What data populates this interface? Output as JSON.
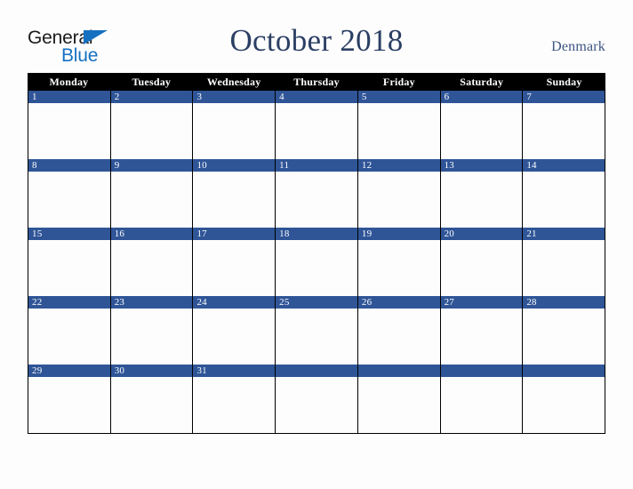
{
  "brand": {
    "logo_line1": "General",
    "logo_line2": "Blue",
    "logo_triangle_icon": "triangle-icon",
    "primary_color": "#1670c0"
  },
  "header": {
    "title": "October 2018",
    "month": "October",
    "year": "2018",
    "country": "Denmark",
    "title_color": "#2b3f64",
    "country_color": "#3d5582"
  },
  "calendar": {
    "weekday_headers": [
      "Monday",
      "Tuesday",
      "Wednesday",
      "Thursday",
      "Friday",
      "Saturday",
      "Sunday"
    ],
    "header_bg_color": "#000000",
    "header_text_color": "#ffffff",
    "date_bar_color": "#2f5597",
    "date_text_color": "#ffffff",
    "cell_bg_color": "#fdfdfd",
    "grid_line_color": "#000000",
    "weeks": [
      {
        "days": [
          {
            "number": "1"
          },
          {
            "number": "2"
          },
          {
            "number": "3"
          },
          {
            "number": "4"
          },
          {
            "number": "5"
          },
          {
            "number": "6"
          },
          {
            "number": "7"
          }
        ]
      },
      {
        "days": [
          {
            "number": "8"
          },
          {
            "number": "9"
          },
          {
            "number": "10"
          },
          {
            "number": "11"
          },
          {
            "number": "12"
          },
          {
            "number": "13"
          },
          {
            "number": "14"
          }
        ]
      },
      {
        "days": [
          {
            "number": "15"
          },
          {
            "number": "16"
          },
          {
            "number": "17"
          },
          {
            "number": "18"
          },
          {
            "number": "19"
          },
          {
            "number": "20"
          },
          {
            "number": "21"
          }
        ]
      },
      {
        "days": [
          {
            "number": "22"
          },
          {
            "number": "23"
          },
          {
            "number": "24"
          },
          {
            "number": "25"
          },
          {
            "number": "26"
          },
          {
            "number": "27"
          },
          {
            "number": "28"
          }
        ]
      },
      {
        "days": [
          {
            "number": "29"
          },
          {
            "number": "30"
          },
          {
            "number": "31"
          },
          {
            "number": ""
          },
          {
            "number": ""
          },
          {
            "number": ""
          },
          {
            "number": ""
          }
        ]
      }
    ]
  }
}
